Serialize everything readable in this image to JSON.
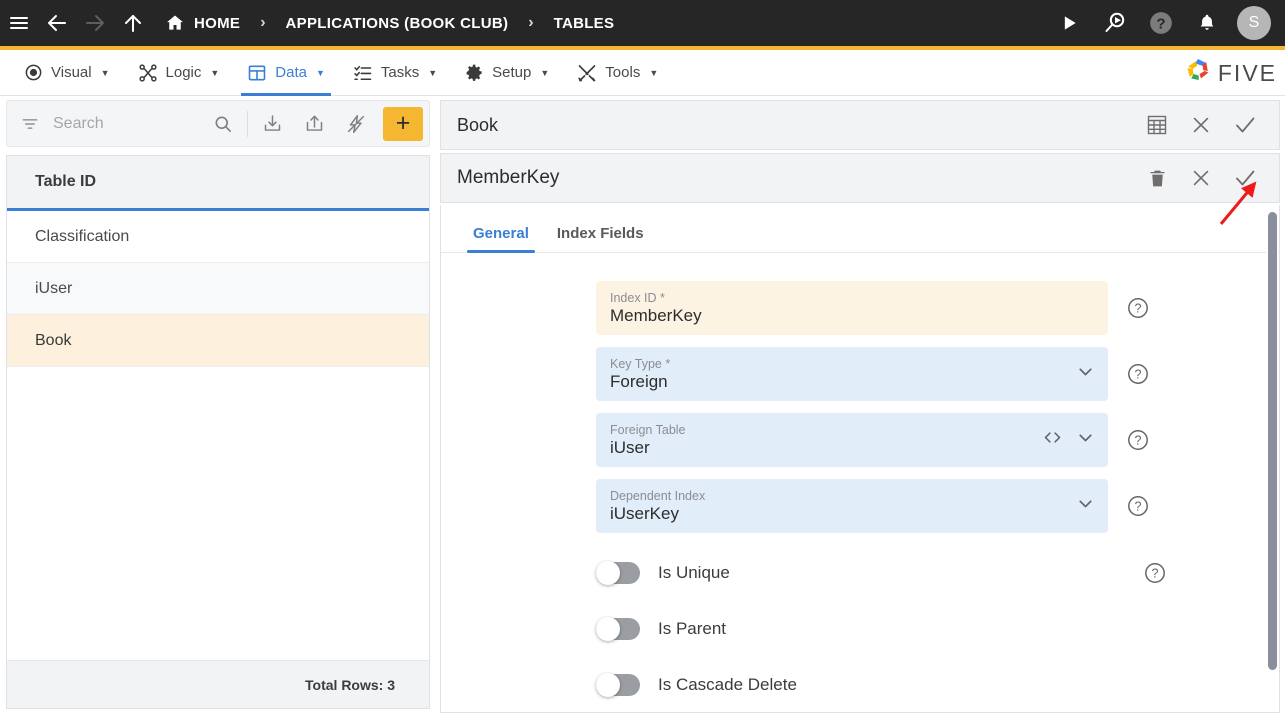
{
  "topbar": {
    "menu_icon": "hamburger-icon",
    "back_icon": "arrow-left-icon",
    "forward_icon": "arrow-right-icon",
    "up_icon": "arrow-up-icon",
    "home_icon": "home-icon",
    "breadcrumb": [
      {
        "label": "HOME"
      },
      {
        "label": "APPLICATIONS (BOOK CLUB)"
      },
      {
        "label": "TABLES"
      }
    ],
    "separator": "›",
    "actions": [
      {
        "name": "run-button",
        "icon": "play-icon"
      },
      {
        "name": "search-run-button",
        "icon": "search-play-icon"
      },
      {
        "name": "help-button",
        "icon": "question-circle-icon"
      },
      {
        "name": "notifications-button",
        "icon": "bell-icon"
      }
    ],
    "avatar_initial": "S",
    "accent_color": "#f5b731",
    "background_color": "#262626"
  },
  "menubar": {
    "items": [
      {
        "label": "Visual",
        "icon": "eye-icon",
        "active": false
      },
      {
        "label": "Logic",
        "icon": "logic-nodes-icon",
        "active": false
      },
      {
        "label": "Data",
        "icon": "table-grid-icon",
        "active": true
      },
      {
        "label": "Tasks",
        "icon": "task-list-icon",
        "active": false
      },
      {
        "label": "Setup",
        "icon": "gear-icon",
        "active": false
      },
      {
        "label": "Tools",
        "icon": "tools-icon",
        "active": false
      }
    ],
    "caret": "▼",
    "brand": "FIVE",
    "active_color": "#3a7fd5"
  },
  "sidebar": {
    "search": {
      "placeholder": "Search",
      "value": ""
    },
    "toolbar": [
      {
        "name": "filter-icon"
      },
      {
        "name": "search-icon"
      },
      {
        "name": "import-icon"
      },
      {
        "name": "export-icon"
      },
      {
        "name": "lightning-icon"
      },
      {
        "name": "add-button",
        "label": "+"
      }
    ],
    "column_header": "Table ID",
    "rows": [
      {
        "label": "Classification",
        "selected": false
      },
      {
        "label": "iUser",
        "selected": false
      },
      {
        "label": "Book",
        "selected": true
      }
    ],
    "footer": "Total Rows: 3",
    "selected_row_color": "#fdf1dd"
  },
  "record_header": {
    "title": "Book",
    "actions": [
      {
        "name": "table-view-icon"
      },
      {
        "name": "close-icon"
      },
      {
        "name": "save-check-icon"
      }
    ]
  },
  "detail_header": {
    "title": "MemberKey",
    "actions": [
      {
        "name": "delete-icon"
      },
      {
        "name": "close-icon"
      },
      {
        "name": "save-check-icon"
      }
    ]
  },
  "tabs": [
    {
      "label": "General",
      "active": true
    },
    {
      "label": "Index Fields",
      "active": false
    }
  ],
  "form": {
    "fields": [
      {
        "label": "Index ID",
        "required": true,
        "value": "MemberKey",
        "style": "cream",
        "dropdown": false,
        "code_icon": false,
        "help": true
      },
      {
        "label": "Key Type",
        "required": true,
        "value": "Foreign",
        "style": "blue",
        "dropdown": true,
        "code_icon": false,
        "help": true
      },
      {
        "label": "Foreign Table",
        "required": false,
        "value": "iUser",
        "style": "blue",
        "dropdown": true,
        "code_icon": true,
        "help": true
      },
      {
        "label": "Dependent Index",
        "required": false,
        "value": "iUserKey",
        "style": "blue",
        "dropdown": true,
        "code_icon": false,
        "help": true
      }
    ],
    "toggles": [
      {
        "label": "Is Unique",
        "on": false,
        "help": true
      },
      {
        "label": "Is Parent",
        "on": false,
        "help": false
      },
      {
        "label": "Is Cascade Delete",
        "on": false,
        "help": false
      }
    ],
    "required_marker": "*"
  },
  "annotation": {
    "arrow_color": "#ee1b1b",
    "points_to": "save-check-icon"
  }
}
